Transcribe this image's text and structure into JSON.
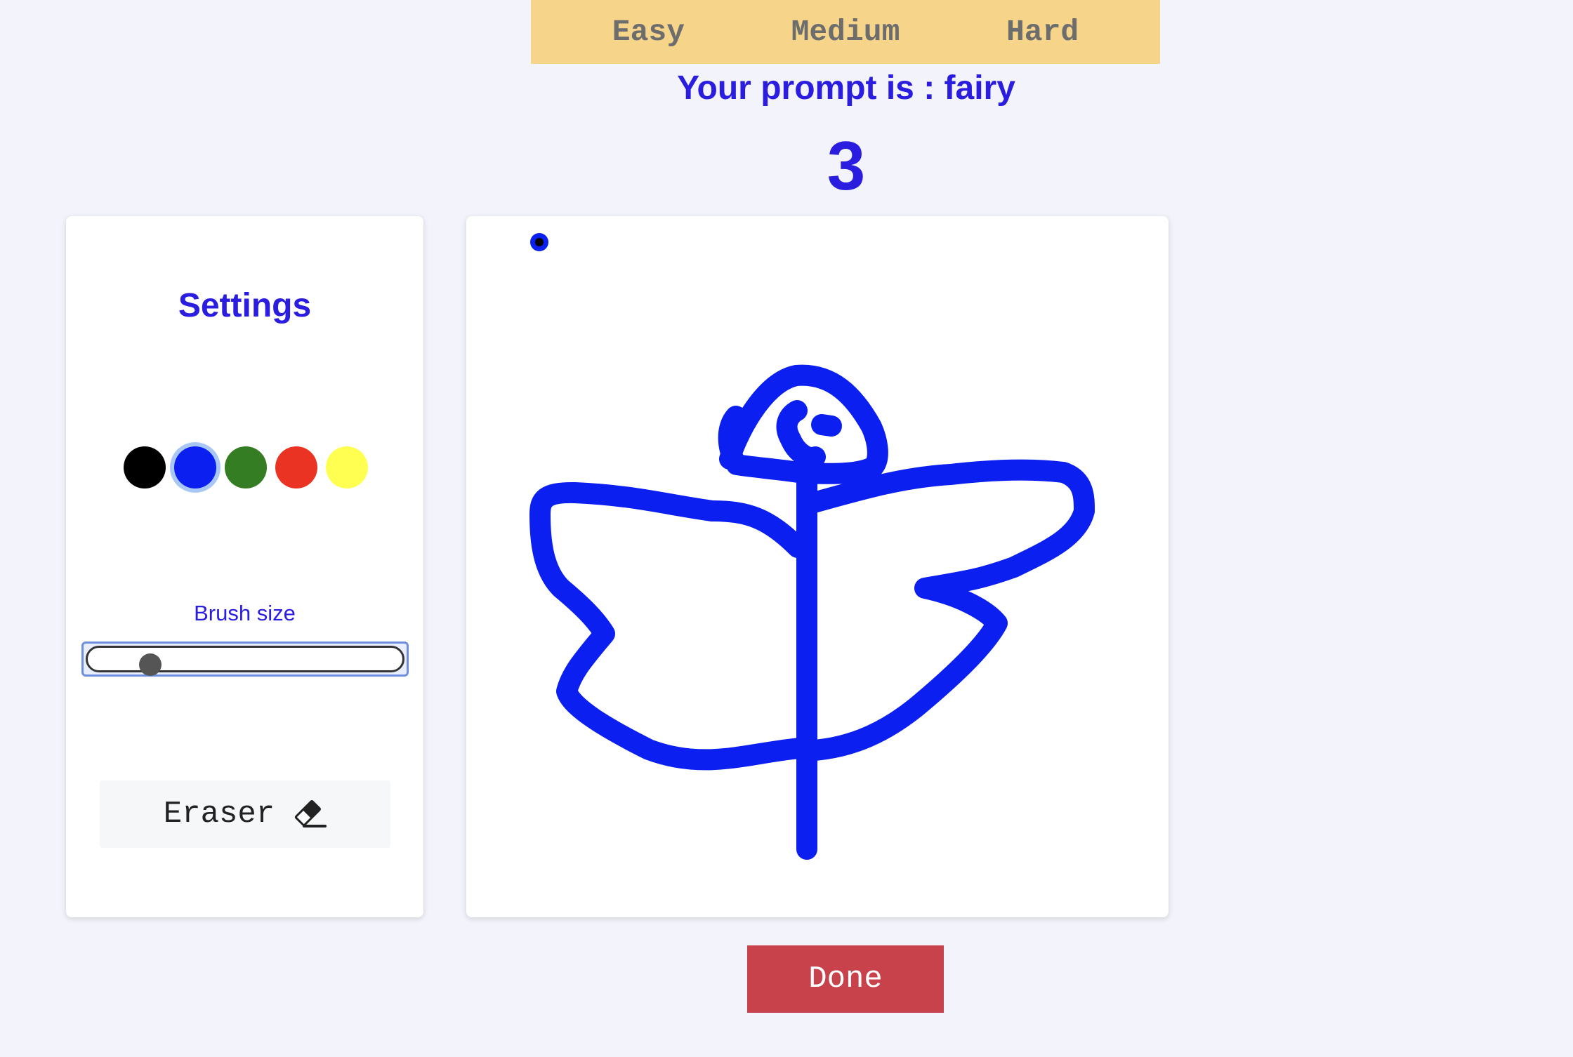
{
  "difficulty_tabs": [
    "Easy",
    "Medium",
    "Hard"
  ],
  "prompt_text": "Your prompt is : fairy",
  "timer": "3",
  "settings": {
    "title": "Settings",
    "colors": [
      {
        "name": "black",
        "hex": "#000000",
        "selected": false
      },
      {
        "name": "blue",
        "hex": "#0a1ff0",
        "selected": true
      },
      {
        "name": "green",
        "hex": "#347d22",
        "selected": false
      },
      {
        "name": "red",
        "hex": "#ea3323",
        "selected": false
      },
      {
        "name": "yellow",
        "hex": "#ffff52",
        "selected": false
      }
    ],
    "brush_label": "Brush size",
    "brush_size_fraction": 0.14,
    "eraser_label": "Eraser",
    "eraser_icon": "eraser-icon"
  },
  "canvas": {
    "stroke_color": "#0a1ff0",
    "cursor_icon": "brush-cursor-icon"
  },
  "done_label": "Done",
  "colors": {
    "accent": "#2a1de0",
    "tabs_bg": "#f6d58a",
    "done_bg": "#c8424b",
    "page_bg": "#f3f3fb"
  }
}
